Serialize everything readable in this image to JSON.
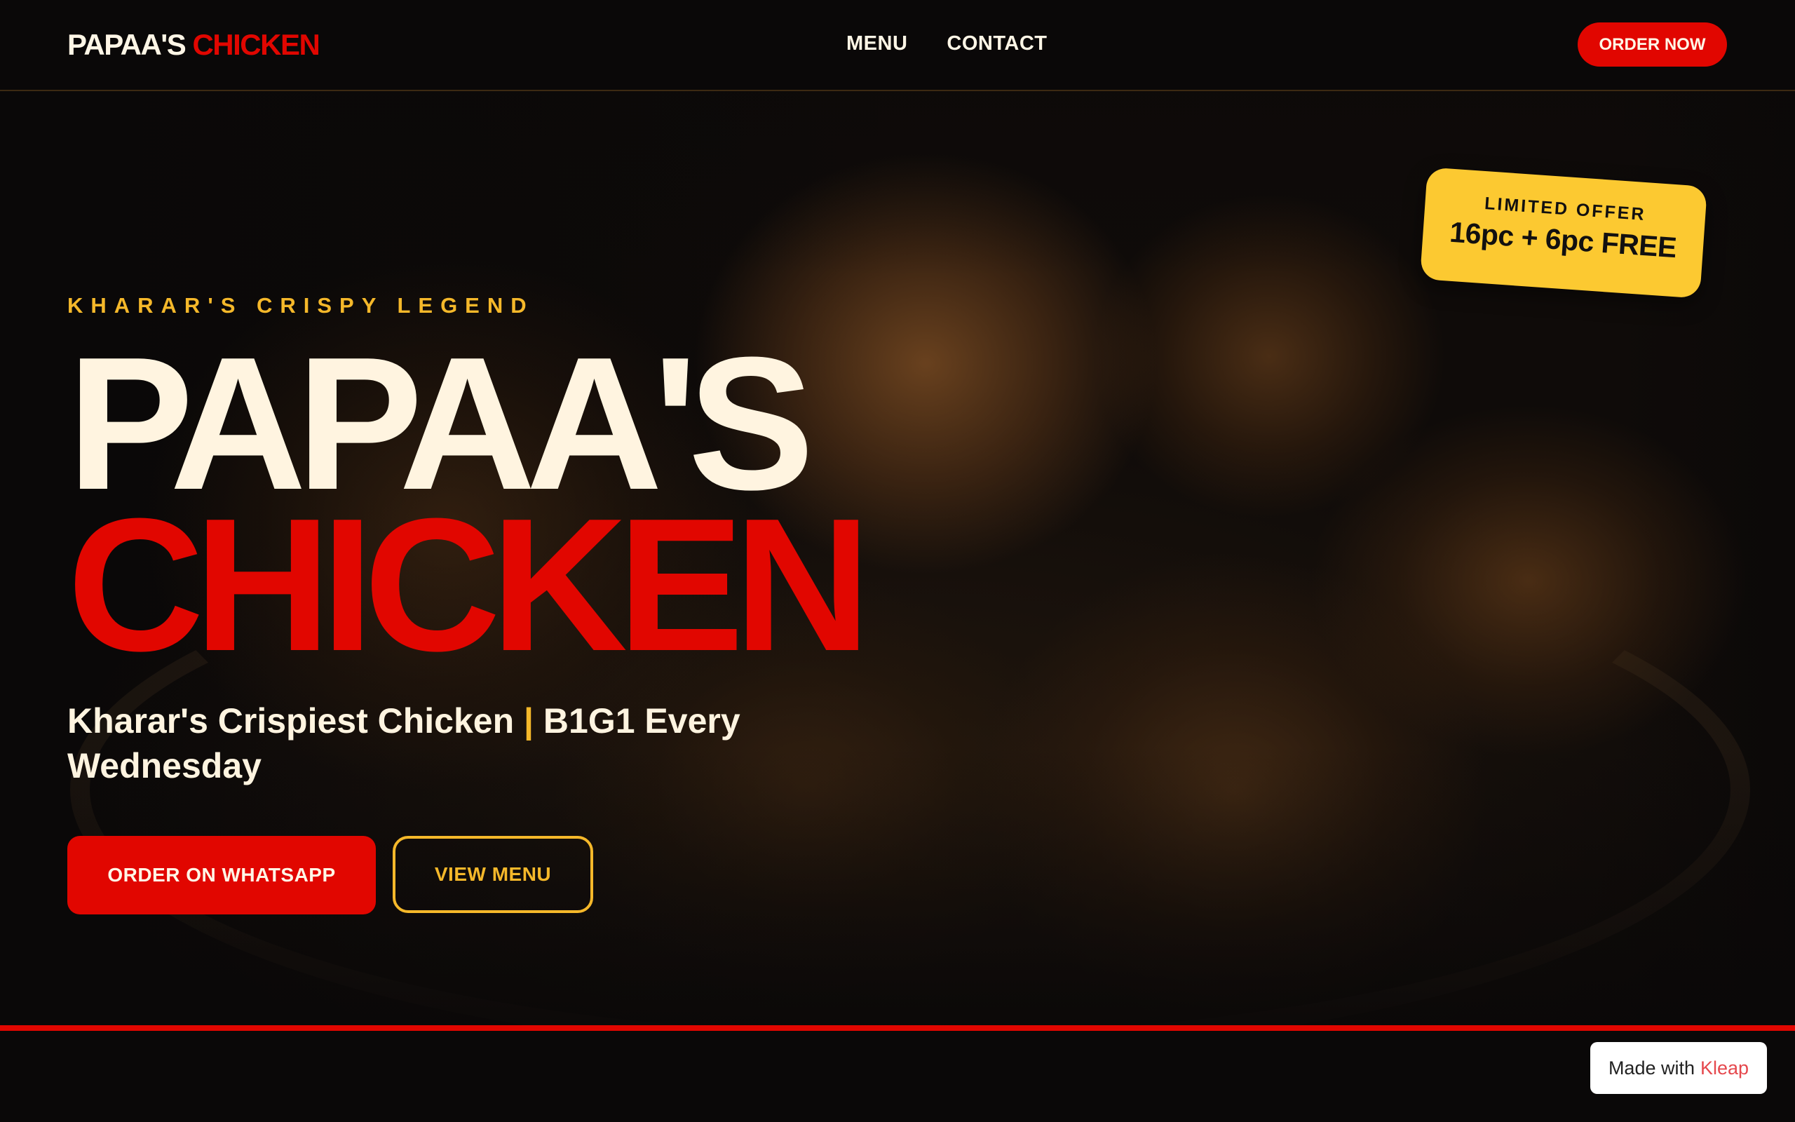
{
  "brand": {
    "name_part1": "PAPAA'S",
    "name_part2": "CHICKEN"
  },
  "nav": {
    "links": [
      {
        "label": "MENU"
      },
      {
        "label": "CONTACT"
      }
    ],
    "cta_label": "ORDER NOW"
  },
  "hero": {
    "eyebrow": "KHARAR'S CRISPY LEGEND",
    "headline_line1": "PAPAA'S",
    "headline_line2": "CHICKEN",
    "tagline_part1": "Kharar's Crispiest Chicken ",
    "tagline_separator": "|",
    "tagline_part2": " B1G1 Every Wednesday",
    "primary_button": "ORDER ON WHATSAPP",
    "secondary_button": "VIEW MENU",
    "background_image": "fried-chicken-bucket-photo"
  },
  "offer_badge": {
    "kicker": "LIMITED OFFER",
    "deal": "16pc + 6pc FREE"
  },
  "footer_badge": {
    "prefix": "Made with",
    "brand": "Kleap"
  },
  "colors": {
    "accent_red": "#e10600",
    "accent_yellow": "#fcc931",
    "text_cream": "#fff4e0",
    "background": "#0a0808"
  }
}
